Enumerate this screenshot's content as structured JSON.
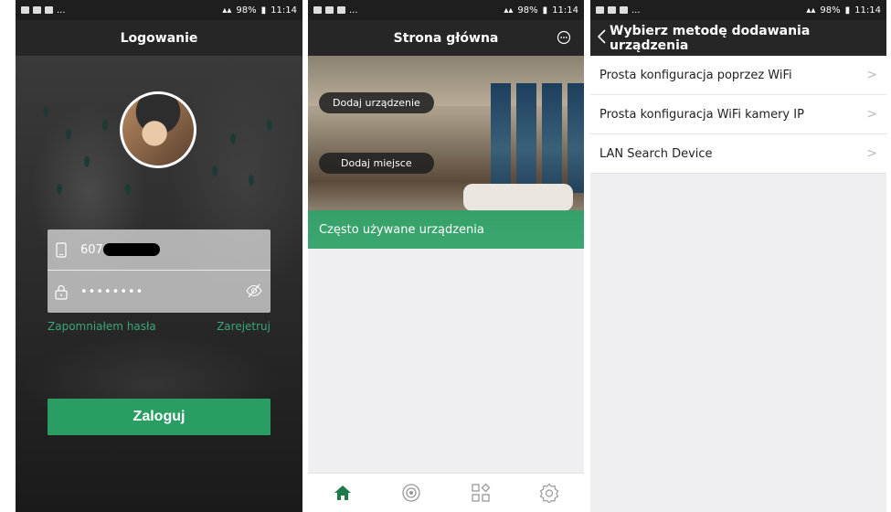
{
  "status_left": [
    "▣",
    "◉",
    "▮",
    "..."
  ],
  "screen1": {
    "status": {
      "battery": "98%",
      "time": "11:14"
    },
    "title": "Logowanie",
    "phone_value": "607",
    "password_value": "••••••••",
    "forgot_label": "Zapomniałem hasła",
    "register_label": "Zarejetruj",
    "login_label": "Zaloguj"
  },
  "screen2": {
    "status": {
      "battery": "98%",
      "time": "11:14"
    },
    "title": "Strona główna",
    "add_device_label": "Dodaj urządzenie",
    "add_place_label": "Dodaj miejsce",
    "frequent_label": "Często używane urządzenia",
    "nav": [
      "home-icon",
      "camera-icon",
      "apps-icon",
      "settings-icon"
    ],
    "accent": "#2a9d62"
  },
  "screen3": {
    "status": {
      "battery": "98%",
      "time": "11:14"
    },
    "title": "Wybierz metodę dodawania urządzenia",
    "items": [
      {
        "label": "Prosta konfiguracja poprzez WiFi"
      },
      {
        "label": "Prosta konfiguracja WiFi kamery IP"
      },
      {
        "label": "LAN Search Device"
      }
    ]
  }
}
